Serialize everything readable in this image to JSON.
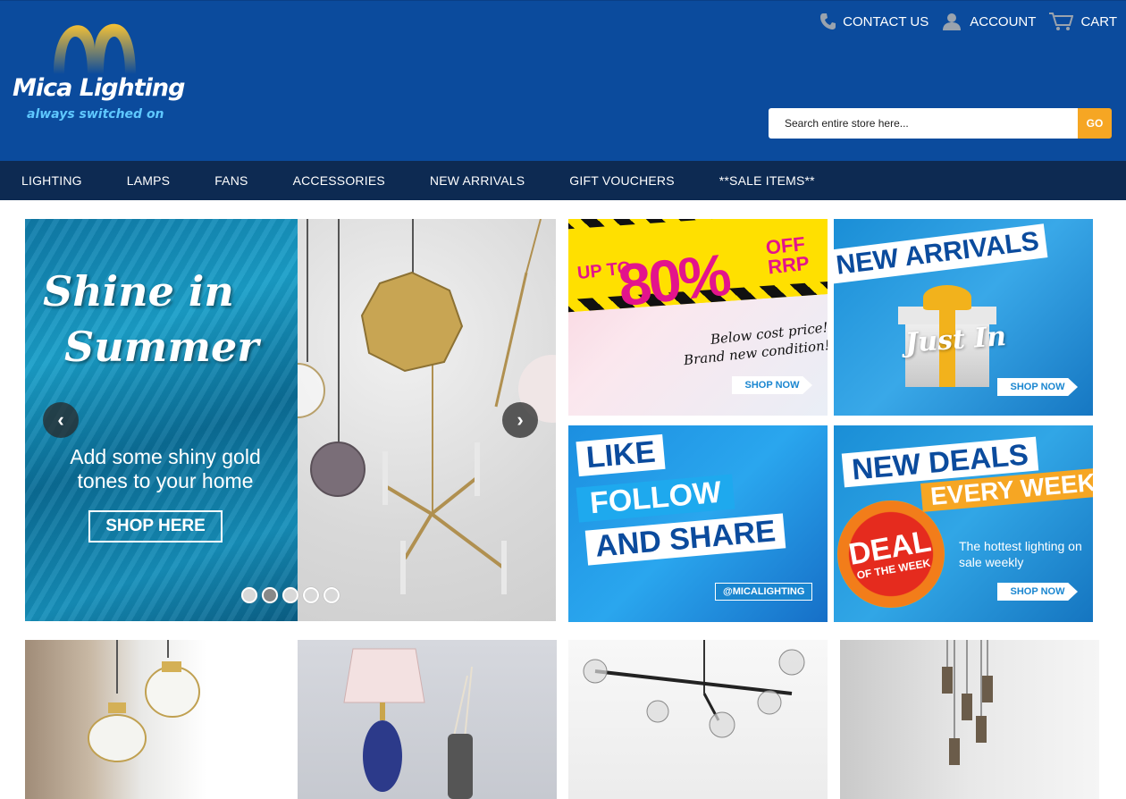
{
  "header": {
    "brand": "Mica Lighting",
    "tagline": "always switched on",
    "links": {
      "contact": "CONTACT US",
      "account": "ACCOUNT",
      "cart": "CART"
    },
    "search": {
      "placeholder": "Search entire store here...",
      "button": "GO"
    }
  },
  "nav": [
    "LIGHTING",
    "LAMPS",
    "FANS",
    "ACCESSORIES",
    "NEW ARRIVALS",
    "GIFT VOUCHERS",
    "**SALE ITEMS**"
  ],
  "hero": {
    "title_line1": "Shine in",
    "title_line2": "Summer",
    "subtitle": "Add some shiny gold tones to your home",
    "button": "SHOP HERE",
    "prev": "‹",
    "next": "›"
  },
  "promos": {
    "sale": {
      "upto": "UP TO",
      "percent": "80%",
      "off": "OFF RRP",
      "condition": "Below cost price! Brand new condition!",
      "cta": "SHOP NOW"
    },
    "arrivals": {
      "title": "NEW ARRIVALS",
      "script": "Just In",
      "cta": "SHOP NOW"
    },
    "social": {
      "line1": "LIKE",
      "line2": "FOLLOW",
      "line3": "AND SHARE",
      "handle": "@MICALIGHTING"
    },
    "deals": {
      "title": "NEW DEALS",
      "sub": "EVERY WEEK",
      "badge_big": "DEAL",
      "badge_small": "OF THE WEEK",
      "desc": "The hottest lighting on sale weekly",
      "cta": "SHOP NOW"
    }
  },
  "colors": {
    "header_bg": "#0b4b9d",
    "nav_bg": "#0d2a52",
    "accent": "#f6a623",
    "tagline": "#5fc8ff"
  }
}
